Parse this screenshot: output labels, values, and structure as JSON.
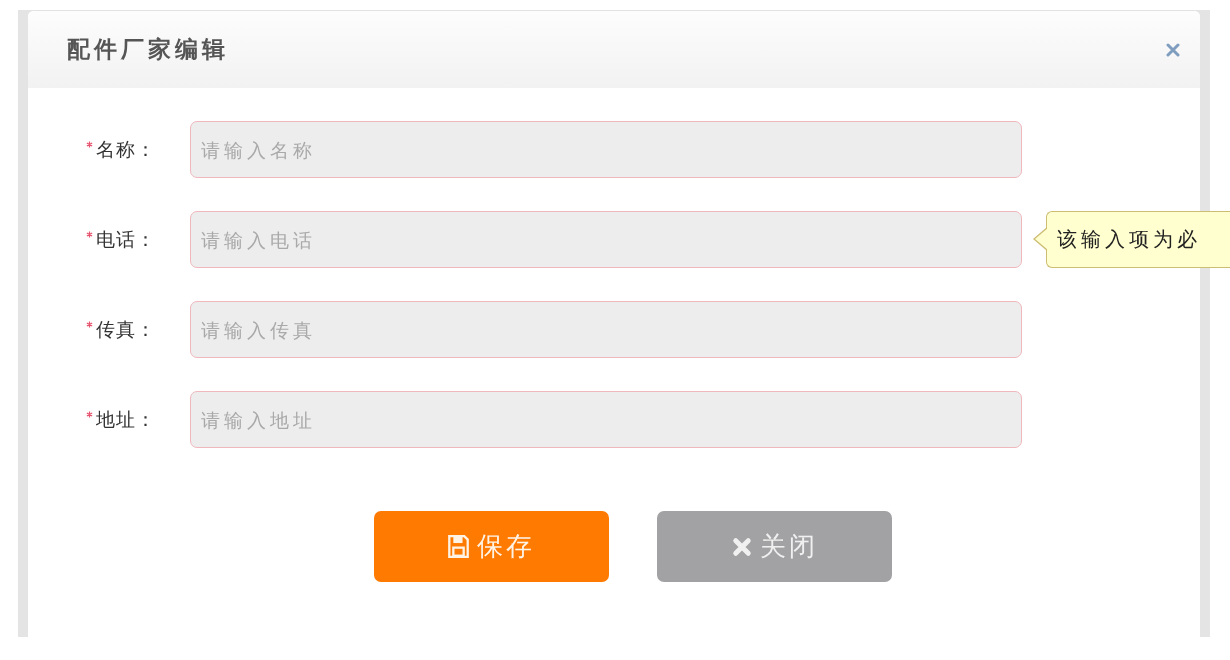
{
  "dialog": {
    "title": "配件厂家编辑"
  },
  "fields": [
    {
      "label": "名称：",
      "required": true,
      "placeholder": "请输入名称"
    },
    {
      "label": "电话：",
      "required": true,
      "placeholder": "请输入电话",
      "tooltip": "该输入项为必"
    },
    {
      "label": "传真：",
      "required": true,
      "placeholder": "请输入传真"
    },
    {
      "label": "地址：",
      "required": true,
      "placeholder": "请输入地址"
    }
  ],
  "buttons": [
    {
      "label": "保存",
      "kind": "save"
    },
    {
      "label": "关闭",
      "kind": "close"
    }
  ]
}
